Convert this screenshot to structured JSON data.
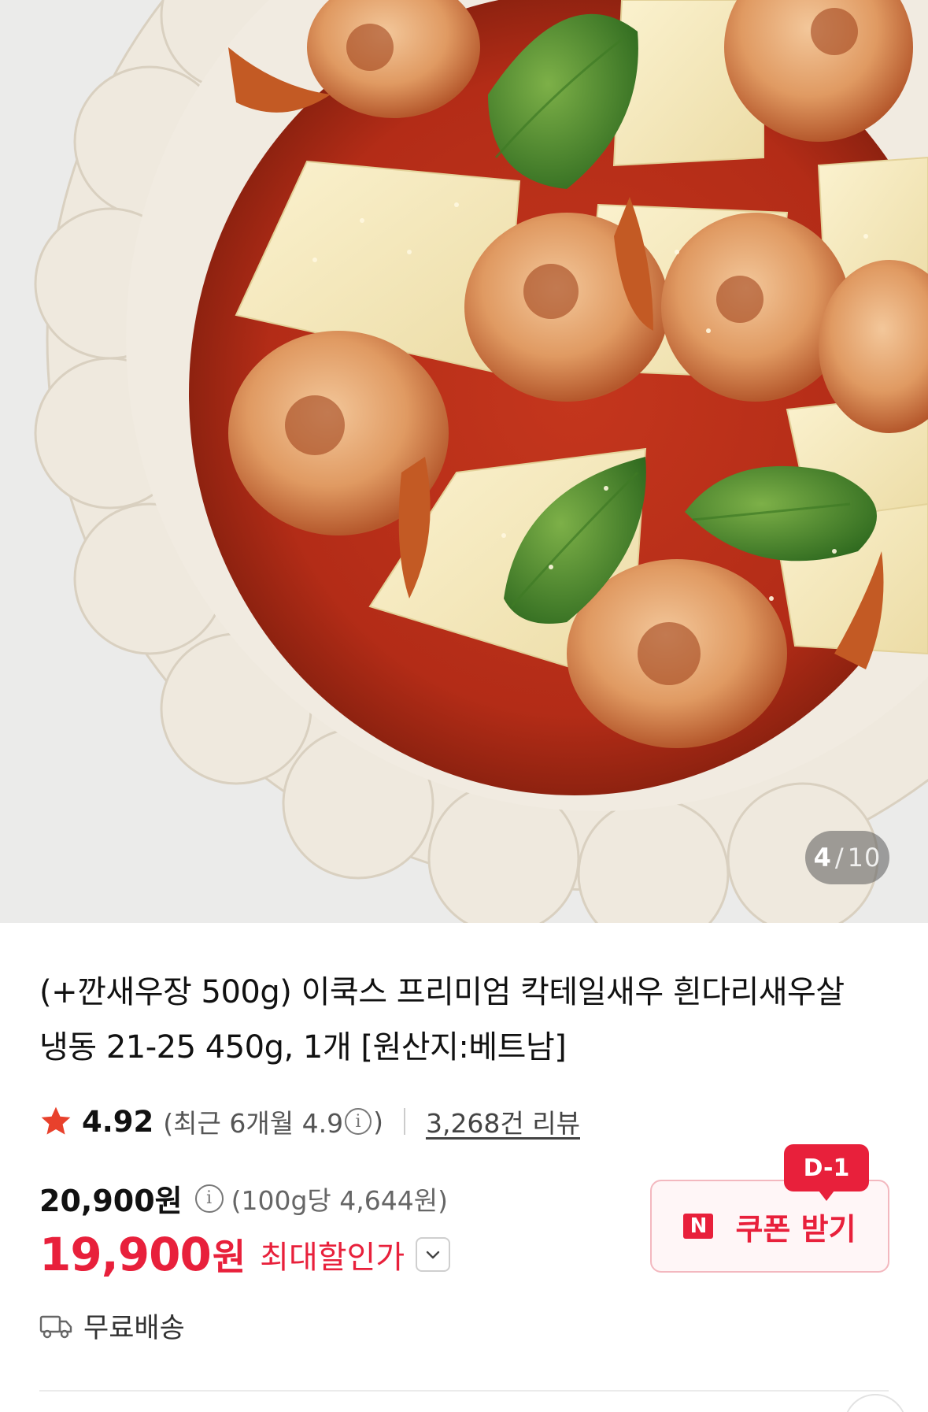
{
  "image": {
    "counter_current": "4",
    "counter_separator": "/",
    "counter_total": "10"
  },
  "product": {
    "title": "(+깐새우장 500g) 이쿡스 프리미엄 칵테일새우 흰다리새우살 냉동 21-25 450g, 1개 [원산지:베트남]"
  },
  "rating": {
    "score": "4.92",
    "recent_prefix": "(최근 6개월 4.9",
    "recent_info": "i",
    "recent_suffix": ")",
    "reviews": "3,268건 리뷰"
  },
  "price": {
    "original": "20,900원",
    "info": "i",
    "unit_price": "(100g당 4,644원)",
    "sale_number": "19,900",
    "sale_won": "원",
    "max_discount": "최대할인가"
  },
  "coupon": {
    "badge": "D-1",
    "logo": "N",
    "label": "쿠폰 받기"
  },
  "shipping": {
    "label": "무료배송"
  },
  "colors": {
    "accent": "#e8203b",
    "star": "#e8412c"
  },
  "icons": [
    "star-icon",
    "info-icon",
    "chevron-down-icon",
    "truck-icon",
    "naver-coupon-icon"
  ]
}
